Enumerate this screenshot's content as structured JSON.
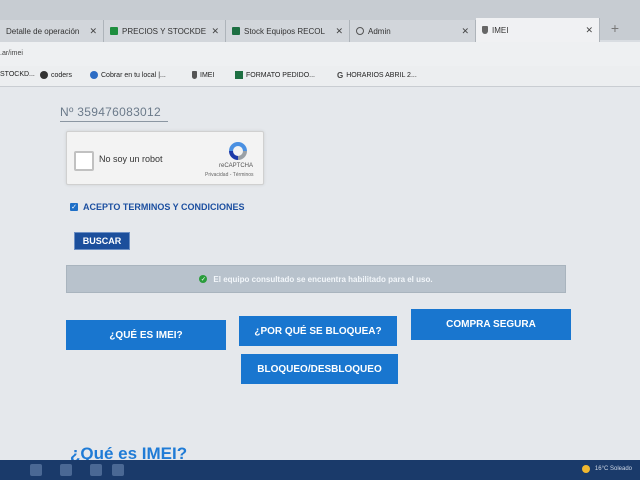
{
  "browser": {
    "tabs": [
      {
        "label": "Detalle de operación",
        "icon": "page-icon",
        "active": false
      },
      {
        "label": "PRECIOS Y STOCKDE",
        "icon": "sheets-icon",
        "active": false
      },
      {
        "label": "Stock Equipos RECOL",
        "icon": "excel-icon",
        "active": false
      },
      {
        "label": "Admin",
        "icon": "globe-icon",
        "active": false
      },
      {
        "label": "IMEI",
        "icon": "imei-icon",
        "active": true
      }
    ],
    "new_tab": "+",
    "address": ".ar/imei",
    "bookmarks": [
      {
        "label": "STOCKD...",
        "icon": "none"
      },
      {
        "label": "coders",
        "icon": "globe-icon"
      },
      {
        "label": "Cobrar en tu local |...",
        "icon": "cloud-icon"
      },
      {
        "label": "IMEI",
        "icon": "imei-icon"
      },
      {
        "label": "FORMATO PEDIDO...",
        "icon": "excel-icon"
      },
      {
        "label": "HORARIOS ABRIL 2...",
        "icon": "google-icon"
      }
    ]
  },
  "form": {
    "imei_value": "Nº 359476083012",
    "recaptcha": {
      "label": "No soy un robot",
      "brand": "reCAPTCHA",
      "links": "Privacidad - Términos"
    },
    "terms_label": "ACEPTO TERMINOS Y CONDICIONES",
    "search_button": "BUSCAR"
  },
  "status_message": "El equipo consultado se encuentra habilitado para el uso.",
  "buttons": {
    "what_is": "¿QUÉ ES IMEI?",
    "why_blocked": "¿POR QUÉ SE BLOQUEA?",
    "safe_buy": "COMPRA SEGURA",
    "block_unblock": "BLOQUEO/DESBLOQUEO"
  },
  "section_heading": "¿Qué es IMEI?",
  "taskbar": {
    "weather": "16°C  Soleado"
  },
  "colors": {
    "accent": "#1976cf",
    "heading": "#1f7bd6",
    "success": "#2a9d3c"
  }
}
